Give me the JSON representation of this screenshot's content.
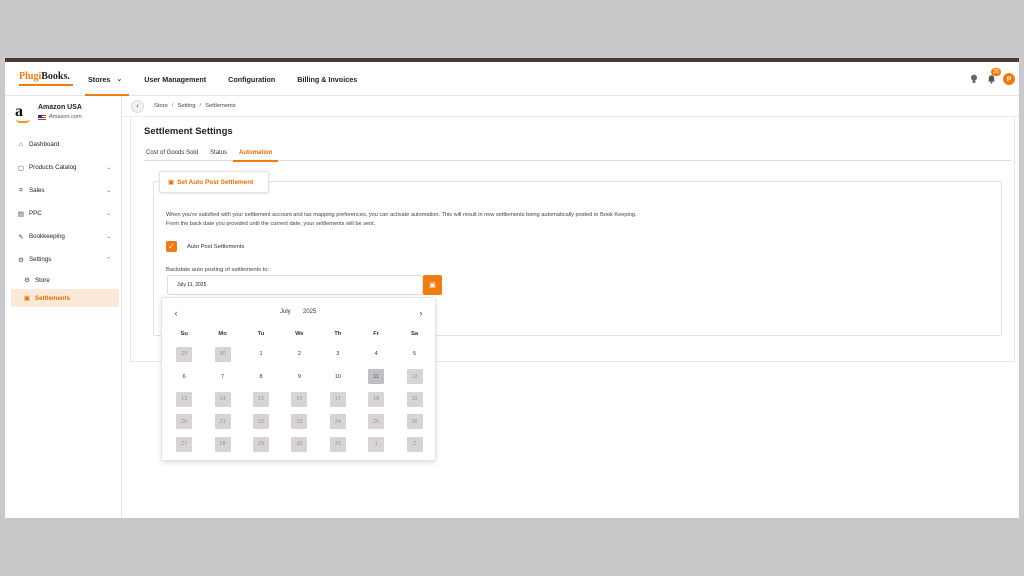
{
  "header": {
    "logo_main": "Plugi",
    "logo_rest": "Books.",
    "nav": [
      {
        "label": "Stores",
        "active": true,
        "has_dropdown": true
      },
      {
        "label": "User Management",
        "active": false
      },
      {
        "label": "Configuration",
        "active": false
      },
      {
        "label": "Billing & Invoices",
        "active": false
      }
    ],
    "notification_count": "26",
    "avatar_initial": "P"
  },
  "sidebar": {
    "store_name": "Amazon USA",
    "store_domain": "Amazon.com",
    "logo_letter": "a",
    "items": [
      {
        "label": "Dashboard",
        "icon": "home-icon"
      },
      {
        "label": "Products Catalog",
        "icon": "box-icon",
        "expand": "down"
      },
      {
        "label": "Sales",
        "icon": "chart-icon",
        "expand": "down"
      },
      {
        "label": "PPC",
        "icon": "ppc-icon",
        "expand": "down"
      },
      {
        "label": "Bookkeeping",
        "icon": "book-icon",
        "expand": "down"
      },
      {
        "label": "Settings",
        "icon": "gear-icon",
        "expand": "up"
      },
      {
        "label": "Store",
        "icon": "gear-icon",
        "sub": true
      },
      {
        "label": "Settlements",
        "icon": "calendar-icon",
        "sub": true,
        "active": true
      }
    ]
  },
  "breadcrumb": [
    "Store",
    "Setting",
    "Settlements"
  ],
  "page": {
    "title": "Settlement Settings",
    "tabs": [
      "Cost of Goods Sold",
      "Status",
      "Automation"
    ],
    "active_tab": "Automation",
    "button_label": "Set Auto Post Settlement",
    "description_line1": "When you're satisfied with your settlement account and tax mapping preferences, you can activate automation. This will result in new settlements being automatically posted to Book Keeping.",
    "description_line2": "From the back date you provided until the current date, your settlements will be sent.",
    "checkbox_label": "Auto Post Settlements",
    "checkbox_checked": true,
    "date_label": "Backdate auto posting of settlements to:",
    "date_value": "July 11, 2025"
  },
  "calendar": {
    "month": "July",
    "year": "2025",
    "weekdays": [
      "Su",
      "Mo",
      "Tu",
      "We",
      "Th",
      "Fr",
      "Sa"
    ],
    "weeks": [
      [
        {
          "d": "29",
          "s": "dis"
        },
        {
          "d": "30",
          "s": "dis"
        },
        {
          "d": "1",
          "s": ""
        },
        {
          "d": "2",
          "s": ""
        },
        {
          "d": "3",
          "s": ""
        },
        {
          "d": "4",
          "s": ""
        },
        {
          "d": "5",
          "s": ""
        }
      ],
      [
        {
          "d": "6",
          "s": ""
        },
        {
          "d": "7",
          "s": ""
        },
        {
          "d": "8",
          "s": ""
        },
        {
          "d": "9",
          "s": ""
        },
        {
          "d": "10",
          "s": ""
        },
        {
          "d": "11",
          "s": "sel"
        },
        {
          "d": "12",
          "s": "dis"
        }
      ],
      [
        {
          "d": "13",
          "s": "dis"
        },
        {
          "d": "14",
          "s": "dis"
        },
        {
          "d": "15",
          "s": "dis"
        },
        {
          "d": "16",
          "s": "dis"
        },
        {
          "d": "17",
          "s": "dis"
        },
        {
          "d": "18",
          "s": "dis"
        },
        {
          "d": "19",
          "s": "dis"
        }
      ],
      [
        {
          "d": "20",
          "s": "dis"
        },
        {
          "d": "21",
          "s": "dis"
        },
        {
          "d": "22",
          "s": "dis"
        },
        {
          "d": "23",
          "s": "dis"
        },
        {
          "d": "24",
          "s": "dis"
        },
        {
          "d": "25",
          "s": "dis"
        },
        {
          "d": "26",
          "s": "dis"
        }
      ],
      [
        {
          "d": "27",
          "s": "dis"
        },
        {
          "d": "28",
          "s": "dis"
        },
        {
          "d": "29",
          "s": "dis"
        },
        {
          "d": "30",
          "s": "dis"
        },
        {
          "d": "31",
          "s": "dis"
        },
        {
          "d": "1",
          "s": "dis"
        },
        {
          "d": "2",
          "s": "dis"
        }
      ]
    ]
  },
  "colors": {
    "accent": "#f07b10",
    "accent_light": "#fde9d7",
    "topbar": "#4a3b35"
  }
}
